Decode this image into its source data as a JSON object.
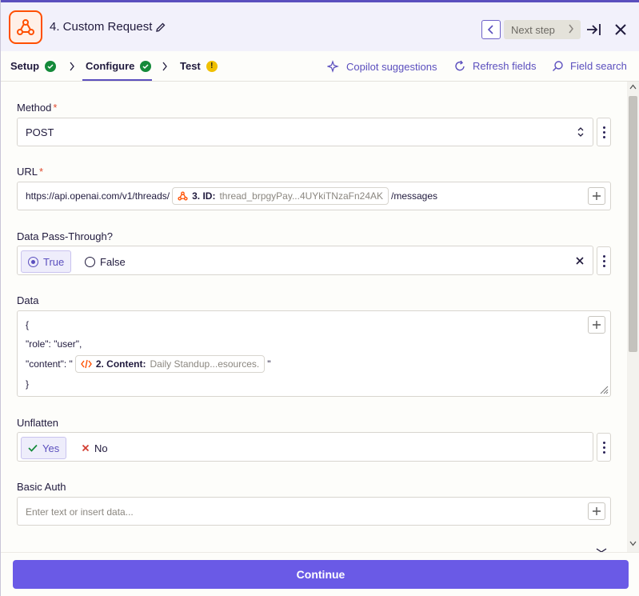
{
  "header": {
    "step_title": "4. Custom Request",
    "next_label": "Next step"
  },
  "tabs": [
    {
      "label": "Setup",
      "status": "complete"
    },
    {
      "label": "Configure",
      "status": "complete",
      "active": true
    },
    {
      "label": "Test",
      "status": "warning"
    }
  ],
  "tools": {
    "copilot": "Copilot suggestions",
    "refresh": "Refresh fields",
    "search": "Field search"
  },
  "method": {
    "label": "Method",
    "value": "POST"
  },
  "url": {
    "label": "URL",
    "prefix": "https://api.openai.com/v1/threads/",
    "pill_key": "3. ID:",
    "pill_value": "thread_brpgyPay...4UYkiTNzaFn24AK",
    "suffix": "/messages"
  },
  "passthrough": {
    "label": "Data Pass-Through?",
    "options": [
      "True",
      "False"
    ],
    "selected": "True"
  },
  "data": {
    "label": "Data",
    "line1": "{",
    "line2": "\"role\": \"user\",",
    "line3_prefix": "\"content\": \"",
    "pill_key": "2. Content:",
    "pill_value": "Daily Standup...esources.",
    "line3_suffix": "\"",
    "line4": "}"
  },
  "unflatten": {
    "label": "Unflatten",
    "yes": "Yes",
    "no": "No",
    "selected": "Yes"
  },
  "basic_auth": {
    "label": "Basic Auth",
    "placeholder": "Enter text or insert data..."
  },
  "footer": {
    "continue_label": "Continue"
  },
  "colors": {
    "accent": "#5b4fbe",
    "button": "#6a5ae6",
    "brand_orange": "#ff4f00",
    "success": "#148a3a",
    "warning": "#f0c000"
  }
}
